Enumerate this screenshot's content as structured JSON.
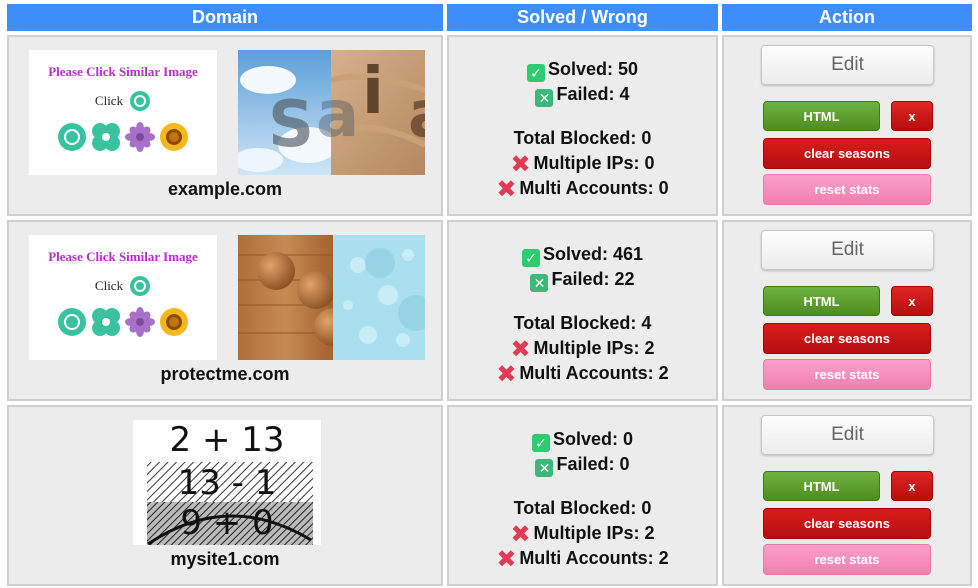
{
  "headers": {
    "domain": "Domain",
    "solved_wrong": "Solved / Wrong",
    "action": "Action"
  },
  "captcha_prompt": {
    "title": "Please Click Similar Image",
    "click": "Click"
  },
  "stat_labels": {
    "solved": "Solved:",
    "failed": "Failed:",
    "total_blocked": "Total Blocked:",
    "multiple_ips": "Multiple IPs:",
    "multi_accounts": "Multi Accounts:"
  },
  "actions": {
    "edit": "Edit",
    "html": "HTML",
    "x": "x",
    "clear": "clear seasons",
    "reset": "reset stats"
  },
  "rows": [
    {
      "domain": "example.com",
      "solved": "50",
      "failed": "4",
      "total_blocked": "0",
      "multiple_ips": "0",
      "multi_accounts": "0",
      "captcha_type": "image-match",
      "image_letters": [
        "S",
        "a",
        "i",
        "a"
      ]
    },
    {
      "domain": "protectme.com",
      "solved": "461",
      "failed": "22",
      "total_blocked": "4",
      "multiple_ips": "2",
      "multi_accounts": "2",
      "captcha_type": "image-match"
    },
    {
      "domain": "mysite1.com",
      "solved": "0",
      "failed": "0",
      "total_blocked": "0",
      "multiple_ips": "2",
      "multi_accounts": "2",
      "captcha_type": "math",
      "math_lines": [
        "2 + 13",
        "13 - 1",
        "9 + 0"
      ]
    }
  ],
  "colors": {
    "header_bg": "#3d8ef8",
    "cell_bg": "#ececec",
    "solved_icon": "#2ecc71",
    "cross_icon": "#e03a55"
  },
  "icons": {
    "solved": "check-box-icon",
    "failed": "x-box-icon",
    "blocked": "red-cross-icon"
  }
}
